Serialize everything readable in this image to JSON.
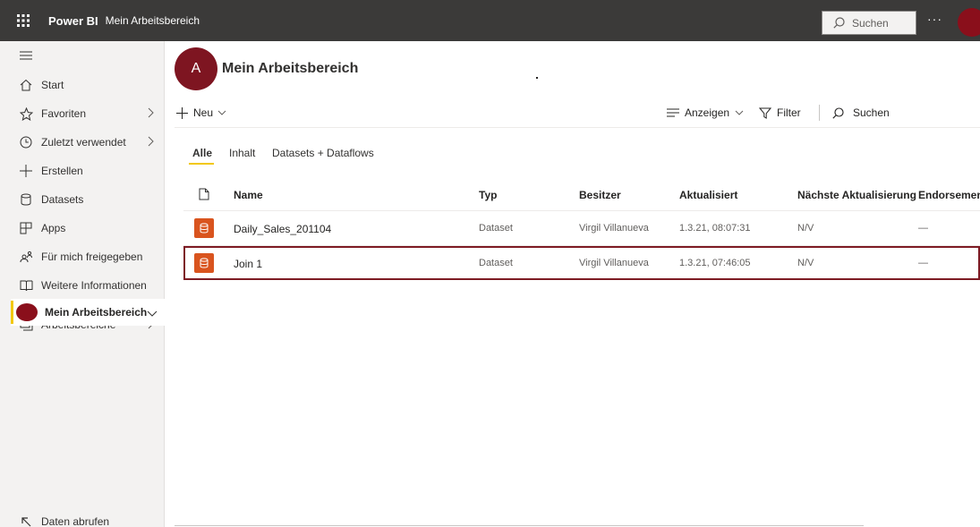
{
  "header": {
    "app_name": "Power BI",
    "breadcrumb": "Mein Arbeitsbereich",
    "search_placeholder": "Suchen",
    "more_label": "···"
  },
  "sidebar": {
    "items": [
      {
        "label": "Start",
        "icon": "home-icon"
      },
      {
        "label": "Favoriten",
        "icon": "star-icon"
      },
      {
        "label": "Zuletzt verwendet",
        "icon": "clock-icon"
      },
      {
        "label": "Erstellen",
        "icon": "plus-icon"
      },
      {
        "label": "Datasets",
        "icon": "database-icon"
      },
      {
        "label": "Apps",
        "icon": "apps-icon"
      },
      {
        "label": "Für mich freigegeben",
        "icon": "shared-icon"
      },
      {
        "label": "Weitere Informationen",
        "icon": "book-icon"
      }
    ],
    "workspaces_label": "Arbeitsbereiche",
    "active_workspace": "Mein Arbeitsbereich",
    "footer_label": "Daten abrufen"
  },
  "workspace": {
    "avatar_letter": "A",
    "title": "Mein Arbeitsbereich"
  },
  "commands": {
    "new_label": "Neu",
    "view_label": "Anzeigen",
    "filter_label": "Filter",
    "search_label": "Suchen"
  },
  "tabs": [
    "Alle",
    "Inhalt",
    "Datasets + Dataflows"
  ],
  "table": {
    "columns": [
      "Name",
      "Typ",
      "Besitzer",
      "Aktualisiert",
      "Nächste Aktualisierung",
      "Endorsement"
    ],
    "rows": [
      {
        "name": "Daily_Sales_201104",
        "type": "Dataset",
        "owner": "Virgil Villanueva",
        "updated": "1.3.21, 08:07:31",
        "next": "N/V",
        "endorsement": "—"
      },
      {
        "name": "Join 1",
        "type": "Dataset",
        "owner": "Virgil Villanueva",
        "updated": "1.3.21, 07:46:05",
        "next": "N/V",
        "endorsement": "—"
      }
    ]
  },
  "colors": {
    "topbar": "#3b3a39",
    "accent_yellow": "#f2c811",
    "avatar_red": "#8a0f1b",
    "dataset_orange": "#d9541e",
    "selection_border": "#7d1b24"
  }
}
